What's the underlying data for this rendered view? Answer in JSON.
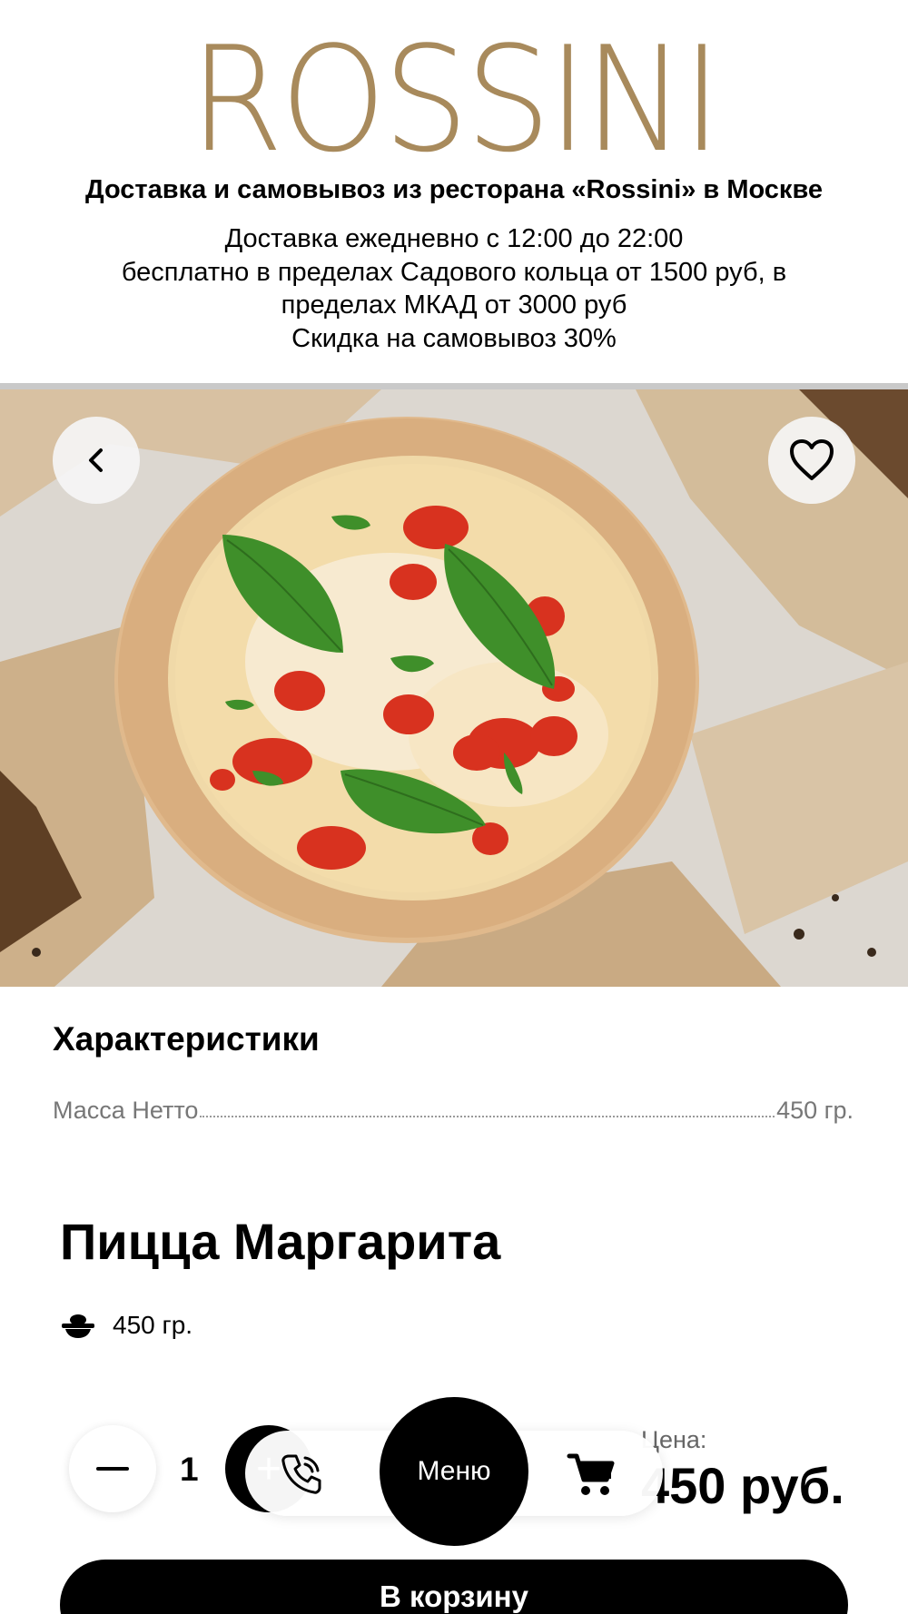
{
  "header": {
    "logo_text": "ROSSINI",
    "subtitle": "Доставка и самовывоз из ресторана «Rossini» в Москве",
    "info_lines": [
      "Доставка ежедневно с 12:00 до 22:00",
      "бесплатно в пределах Садового кольца от 1500 руб, в",
      "пределах МКАД от 3000 руб",
      "Скидка на самовывоз 30%"
    ],
    "logo_color": "#a88a5c"
  },
  "hero": {
    "back_icon": "chevron-left-icon",
    "favorite_icon": "heart-icon",
    "image": "pizza-margherita-photo"
  },
  "characteristics": {
    "title": "Характеристики",
    "rows": [
      {
        "label": "Масса Нетто",
        "value": "450 гр."
      }
    ]
  },
  "product": {
    "name": "Пицца Маргарита",
    "weight_icon": "dish-icon",
    "weight": "450 гр.",
    "price_label": "Цена:",
    "price": "450 руб."
  },
  "quantity": {
    "value": "1",
    "minus_icon": "minus-icon",
    "plus_icon": "plus-icon",
    "plus_symbol": "+"
  },
  "bottom_nav": {
    "phone_icon": "phone-icon",
    "menu_label": "Меню",
    "cart_icon": "cart-icon"
  },
  "cart_button": {
    "label": "В корзину"
  }
}
